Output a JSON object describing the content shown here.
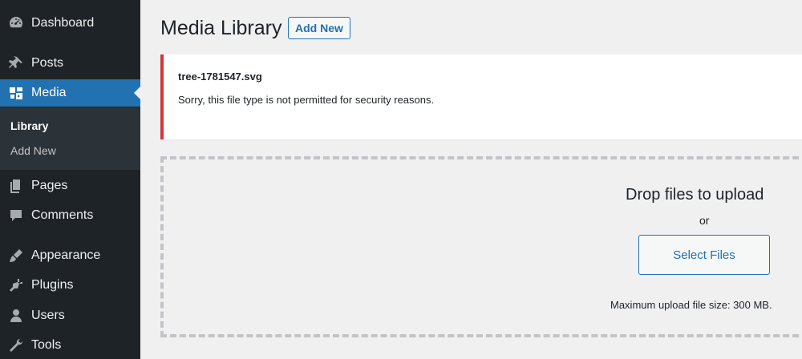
{
  "sidebar": {
    "items": [
      {
        "label": "Dashboard",
        "icon": "dashboard-icon"
      },
      {
        "label": "Posts",
        "icon": "pin-icon"
      },
      {
        "label": "Media",
        "icon": "media-icon",
        "active": true
      },
      {
        "label": "Pages",
        "icon": "pages-icon"
      },
      {
        "label": "Comments",
        "icon": "comment-icon"
      },
      {
        "label": "Appearance",
        "icon": "brush-icon"
      },
      {
        "label": "Plugins",
        "icon": "plug-icon"
      },
      {
        "label": "Users",
        "icon": "user-icon"
      },
      {
        "label": "Tools",
        "icon": "wrench-icon"
      }
    ],
    "submenu": [
      {
        "label": "Library",
        "current": true
      },
      {
        "label": "Add New"
      }
    ]
  },
  "header": {
    "title": "Media Library",
    "add_new_label": "Add New"
  },
  "notice": {
    "filename": "tree-1781547.svg",
    "message": "Sorry, this file type is not permitted for security reasons."
  },
  "uploader": {
    "title": "Drop files to upload",
    "or": "or",
    "select_label": "Select Files",
    "max_size": "Maximum upload file size: 300 MB."
  },
  "colors": {
    "sidebar_bg": "#1d2327",
    "accent": "#2271b1",
    "error": "#d63638",
    "page_bg": "#f0f0f1"
  }
}
